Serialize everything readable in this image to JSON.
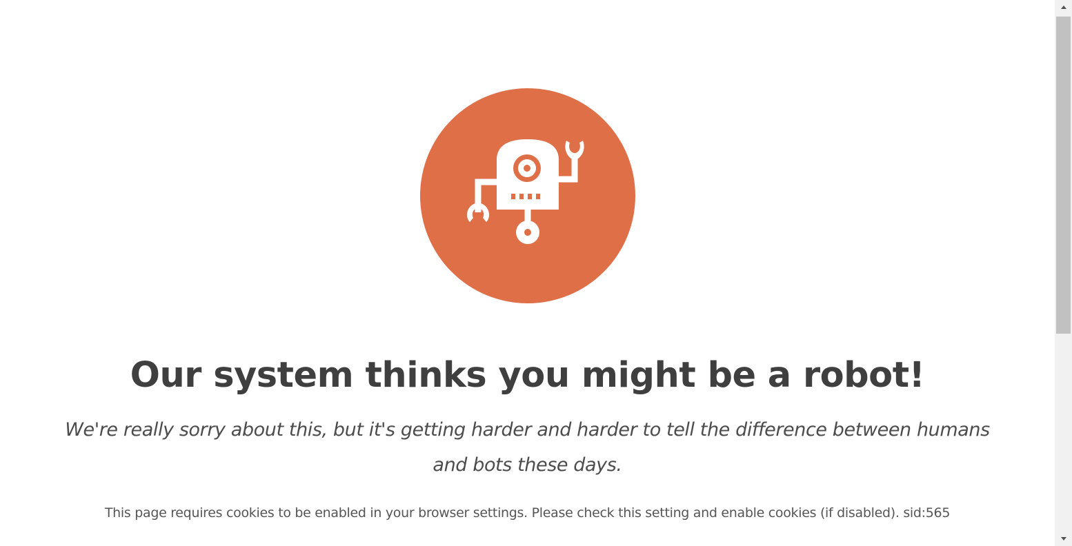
{
  "robot_icon": {
    "name": "robot-icon",
    "circle_color": "#de6f47",
    "glyph_color": "#ffffff"
  },
  "headline": "Our system thinks you might be a robot!",
  "subtitle": "We're really sorry about this, but it's getting harder and harder to tell the difference between humans and bots these days.",
  "notice": "This page requires cookies to be enabled in your browser settings. Please check this setting and enable cookies (if disabled). sid:565",
  "scrollbar": {
    "up_icon": "triangle-up-icon",
    "down_icon": "triangle-down-icon"
  }
}
